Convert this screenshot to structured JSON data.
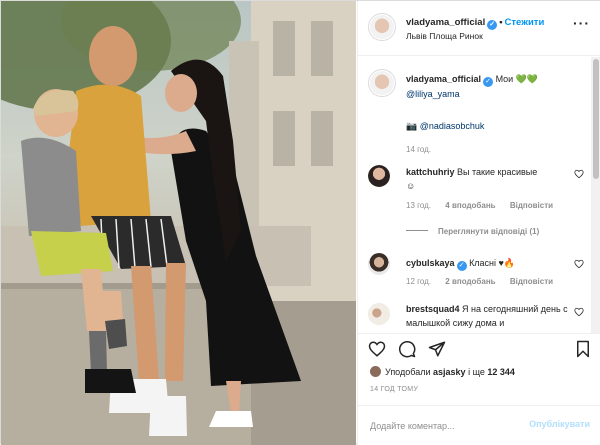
{
  "post": {
    "author": {
      "username": "vladyama_official",
      "verified_icon": "verified-badge-icon",
      "follow_label": "Стежити"
    },
    "location": "Львів Площа Ринок",
    "caption": {
      "username": "vladyama_official",
      "text_before": "Мои",
      "emoji": "💚💚",
      "mention": "@liliya_yama",
      "photo_emoji": "📷",
      "photo_credit": "@nadiasobchuk",
      "time": "14 год."
    },
    "comments": [
      {
        "username": "kattchuhriy",
        "text": "Вы такие красивые",
        "emoji": "☺",
        "time": "13 год.",
        "likes": "4 вподобань",
        "reply": "Відповісти",
        "view_replies": "Переглянути відповіді (1)"
      },
      {
        "username": "cybulskaya",
        "verified": true,
        "text": "Класні ♥🔥",
        "time": "12 год.",
        "likes": "2 вподобань",
        "reply": "Відповісти"
      },
      {
        "username": "brestsquad4",
        "text": "Я на сегодняшний день с малышкой сижу дома и"
      }
    ],
    "likes": {
      "prefix": "Уподобали",
      "user": "asjasky",
      "mid": "і ще",
      "count": "12 344"
    },
    "time_ago": "14 ГОД ТОМУ",
    "add_comment": {
      "placeholder": "Додайте коментар...",
      "publish_label": "Опублікувати"
    },
    "colors": {
      "accent": "#0095f6",
      "verified": "#3897f0",
      "publish_disabled": "#b2dffc",
      "muted": "#8e8e8e"
    }
  }
}
